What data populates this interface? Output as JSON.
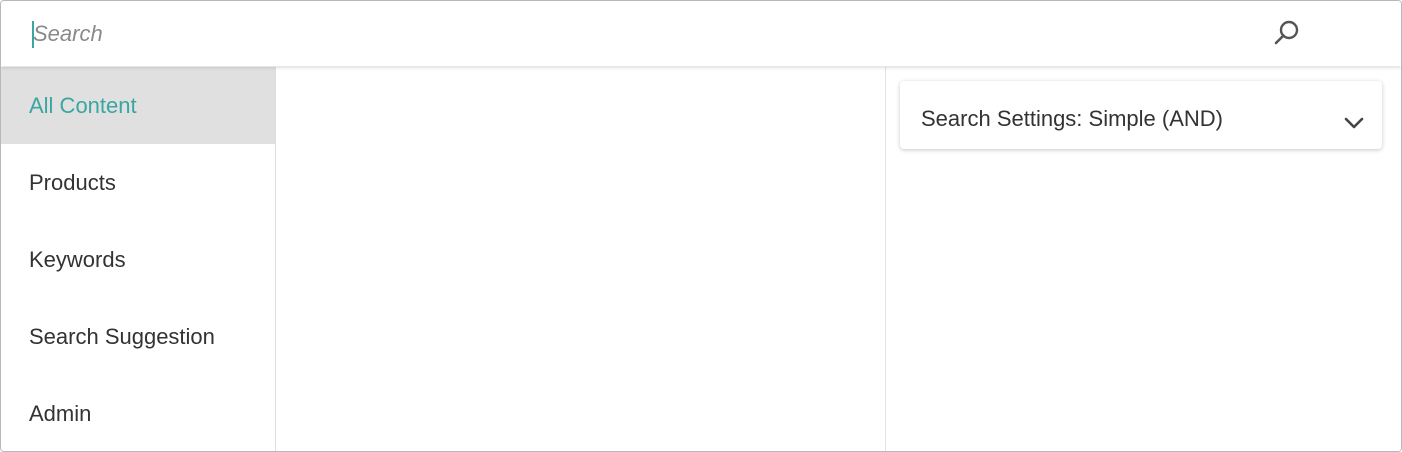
{
  "search": {
    "placeholder": "Search",
    "value": "",
    "button_icon": "search-icon"
  },
  "colors": {
    "accent": "#3aa6a2",
    "active_nav_background": "#e0e0e0",
    "text": "#333333"
  },
  "nav": {
    "items": [
      {
        "label": "All Content",
        "active": true
      },
      {
        "label": "Products",
        "active": false
      },
      {
        "label": "Keywords",
        "active": false
      },
      {
        "label": "Search Suggestion",
        "active": false
      },
      {
        "label": "Admin",
        "active": false
      }
    ]
  },
  "settings": {
    "label": "Search Settings: Simple (AND)",
    "expand_icon": "chevron-down-icon"
  }
}
